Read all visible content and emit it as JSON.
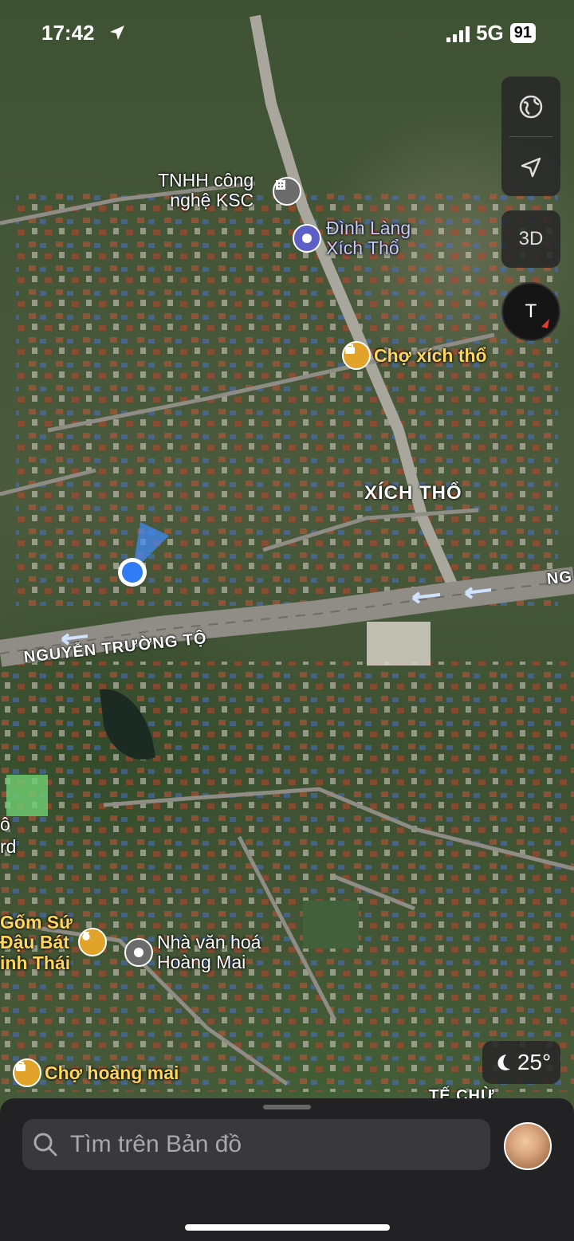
{
  "status_bar": {
    "time": "17:42",
    "network": "5G",
    "battery": "91"
  },
  "map": {
    "poi": [
      {
        "name": "TNHH công\nnghệ KSC",
        "icon": "building-icon",
        "color": "#6b6b6b"
      },
      {
        "name": "Đình Làng\nXích Thổ",
        "icon": "landmark-icon",
        "color": "#5b5fc7"
      },
      {
        "name": "Chợ xích thổ",
        "icon": "shopping-bag-icon",
        "color": "#e2a32a"
      },
      {
        "name": "Gốm Sứ\nĐậu Bát\ninh Thái",
        "icon": "pottery-icon",
        "color": "#e2a32a"
      },
      {
        "name": "Nhà văn hoá\nHoàng Mai",
        "icon": "landmark-icon",
        "color": "#6b6b6b"
      },
      {
        "name": "Chợ hoàng mai",
        "icon": "shopping-bag-icon",
        "color": "#e2a32a"
      }
    ],
    "area_label": "XÍCH THỔ",
    "road_label": "NGUYỄN TRƯỜNG TỘ",
    "edge_labels": {
      "ng": "NG",
      "o": "ô",
      "rd": "rd",
      "te_chu": "TẾ CHỪ"
    }
  },
  "controls": {
    "map_type_icon": "globe-icon",
    "locate_icon": "location-arrow-icon",
    "view_3d": "3D",
    "compass_letter": "T"
  },
  "weather": {
    "icon": "moon-icon",
    "temp": "25°"
  },
  "search": {
    "placeholder": "Tìm trên Bản đồ"
  }
}
